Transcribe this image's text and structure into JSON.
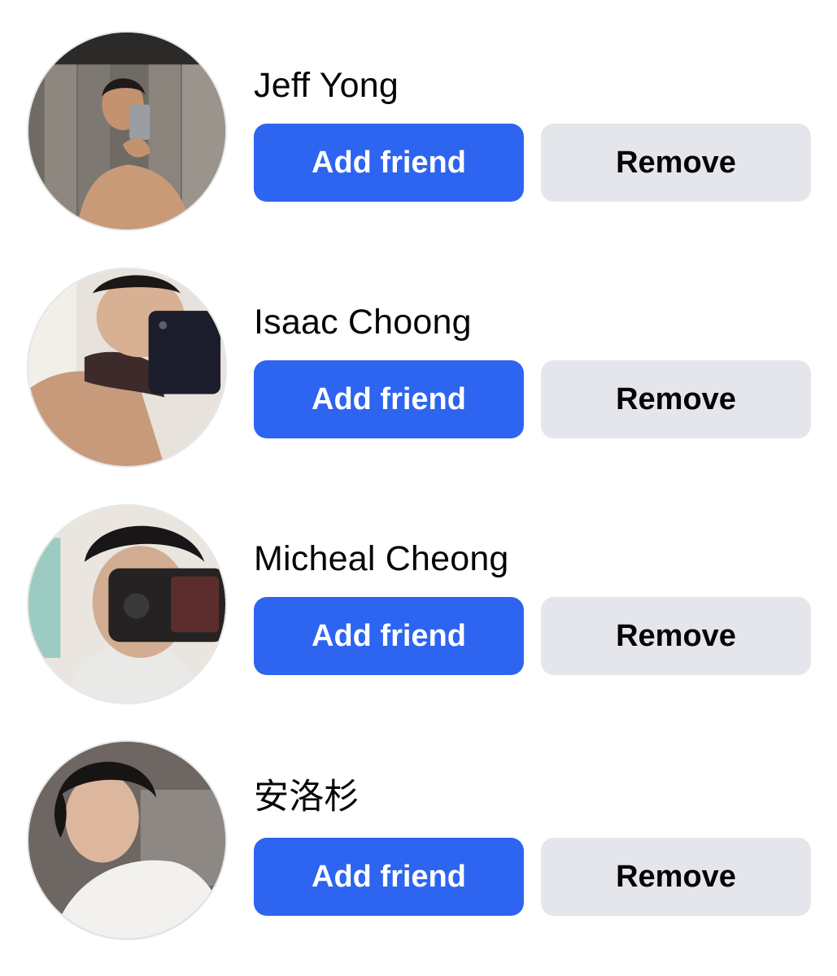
{
  "theme": {
    "primary_button_color": "#2d64f0",
    "secondary_button_color": "#e4e6eb",
    "text_color": "#050505"
  },
  "suggestions": [
    {
      "name": "Jeff Yong",
      "add_label": "Add friend",
      "remove_label": "Remove",
      "avatar_alt": "Profile photo of Jeff Yong"
    },
    {
      "name": "Isaac Choong",
      "add_label": "Add friend",
      "remove_label": "Remove",
      "avatar_alt": "Profile photo of Isaac Choong"
    },
    {
      "name": "Micheal Cheong",
      "add_label": "Add friend",
      "remove_label": "Remove",
      "avatar_alt": "Profile photo of Micheal Cheong"
    },
    {
      "name": "安洛杉",
      "add_label": "Add friend",
      "remove_label": "Remove",
      "avatar_alt": "Profile photo of 安洛杉"
    }
  ]
}
